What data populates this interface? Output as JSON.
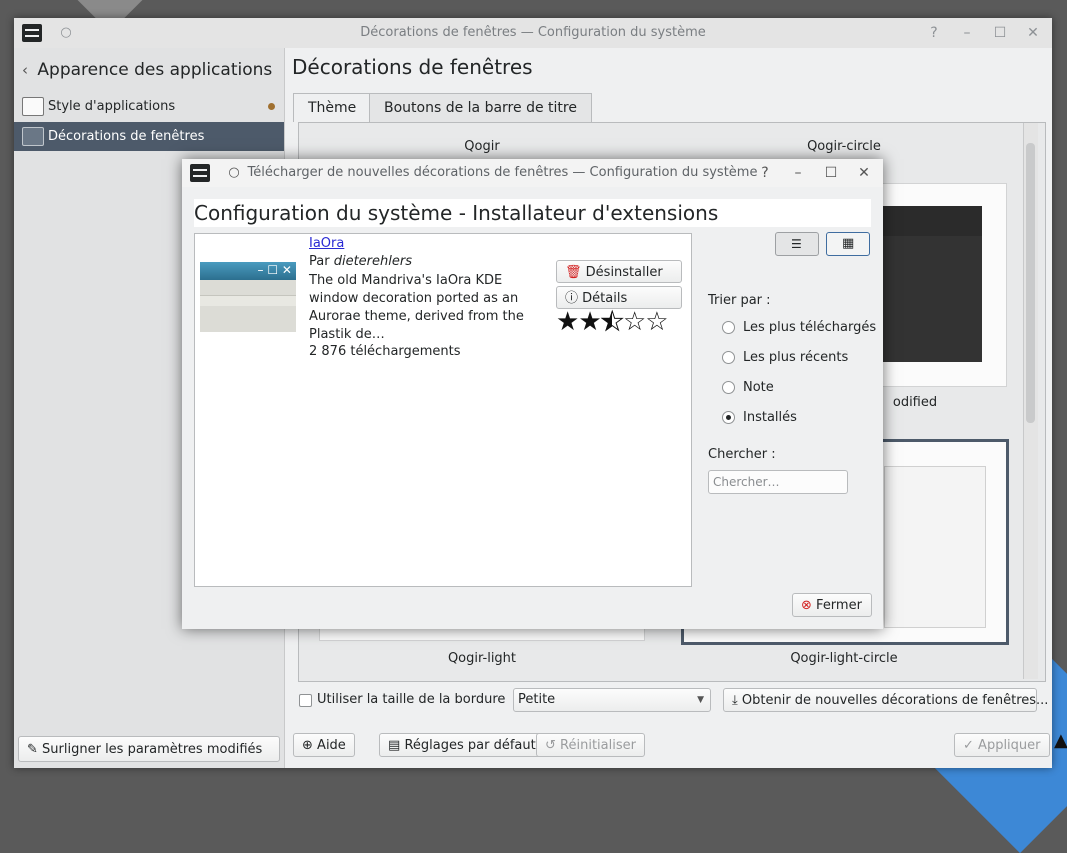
{
  "main_window": {
    "title": "Décorations de fenêtres — Configuration du système",
    "titlebar_buttons": {
      "help": "?",
      "minimize": "–",
      "maximize": "☐",
      "close": "✕"
    }
  },
  "sidebar": {
    "back_label": "Apparence des applications",
    "items": [
      {
        "label": "Style d'applications",
        "modified": true
      },
      {
        "label": "Décorations de fenêtres",
        "selected": true
      }
    ],
    "highlight_button": "Surligner les paramètres modifiés"
  },
  "content": {
    "title": "Décorations de fenêtres",
    "tabs": [
      {
        "label": "Thème",
        "active": true
      },
      {
        "label": "Boutons de la barre de titre",
        "active": false
      }
    ],
    "themes": [
      "Qogir",
      "Qogir-circle",
      "odified",
      "Qogir-light",
      "Qogir-light-circle"
    ],
    "border_checkbox_label": "Utiliser la taille de la bordure de",
    "border_size_value": "Petite",
    "get_new_button": "Obtenir de nouvelles décorations de fenêtres..."
  },
  "footer": {
    "help": "Aide",
    "defaults": "Réglages par défaut",
    "reset": "Réinitialiser",
    "apply": "Appliquer"
  },
  "dialog": {
    "title": "Télécharger de nouvelles décorations de fenêtres — Configuration du système",
    "header": "Configuration du système - Installateur d'extensions",
    "item": {
      "name": "IaOra",
      "by_prefix": "Par",
      "author": "dieterehlers",
      "description": "The old Mandriva's IaOra KDE window decoration ported as an Aurorae theme, derived from the Plastik de…",
      "downloads": "2 876 téléchargements",
      "rating": 2.5,
      "uninstall_button": "Désinstaller",
      "details_button": "Détails"
    },
    "sort_label": "Trier par :",
    "sort_options": [
      {
        "label": "Les plus téléchargés",
        "checked": false
      },
      {
        "label": "Les plus récents",
        "checked": false
      },
      {
        "label": "Note",
        "checked": false
      },
      {
        "label": "Installés",
        "checked": true
      }
    ],
    "search_label": "Chercher :",
    "search_placeholder": "Chercher…",
    "close_button": "Fermer"
  },
  "colors": {
    "selection": "#4d5a6a",
    "link": "#2929d4",
    "danger": "#d32020"
  }
}
